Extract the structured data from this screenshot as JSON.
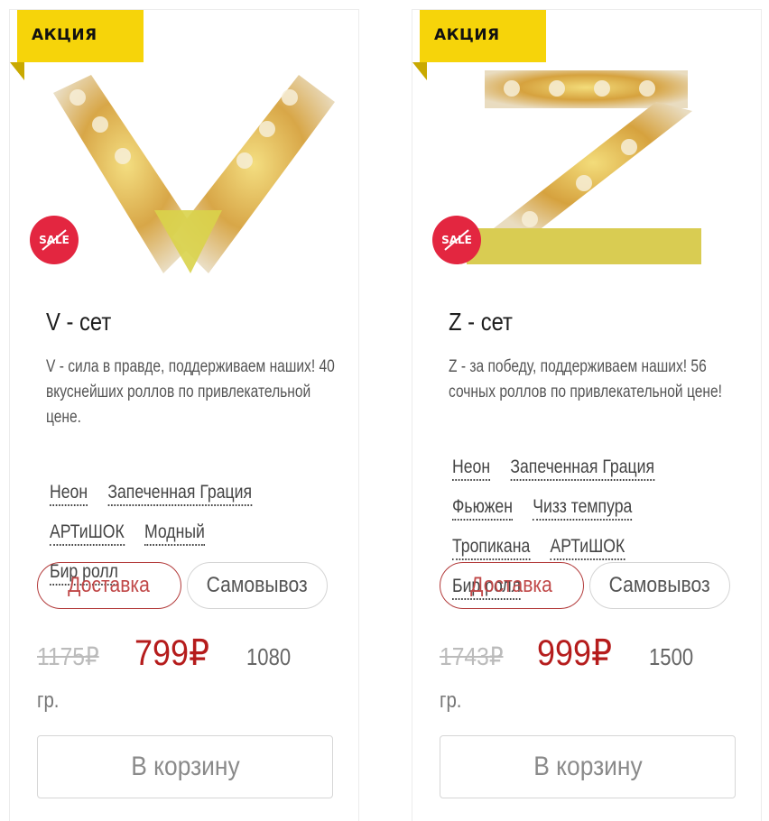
{
  "products": [
    {
      "promo_label": "АКЦИЯ",
      "sale_badge": "SALE",
      "title": "V - сет",
      "description": "V - сила в правде, поддерживаем наших! 40 вкуснейших роллов по привлекательной цене.",
      "tag_rows": [
        [
          "Неон",
          "Запеченная Грация"
        ],
        [
          "АРТиШОК",
          "Модный"
        ],
        [
          "Бир ролл"
        ]
      ],
      "delivery_option": "Доставка",
      "pickup_option": "Самовывоз",
      "old_price": "1175₽",
      "new_price": "799₽",
      "weight": "1080",
      "weight_unit": "гр.",
      "cart_button": "В корзину",
      "image_shape": "V"
    },
    {
      "promo_label": "АКЦИЯ",
      "sale_badge": "SALE",
      "title": "Z - сет",
      "description": "Z - за победу, поддерживаем наших! 56 сочных роллов по привлекательной цене!",
      "tag_rows": [
        [
          "Неон",
          "Запеченная Грация"
        ],
        [
          "Фьюжен",
          "Чизз темпура"
        ],
        [
          "Тропикана",
          "АРТиШОК"
        ],
        [
          "Бир ролл"
        ]
      ],
      "delivery_option": "Доставка",
      "pickup_option": "Самовывоз",
      "old_price": "1743₽",
      "new_price": "999₽",
      "weight": "1500",
      "weight_unit": "гр.",
      "cart_button": "В корзину",
      "image_shape": "Z"
    }
  ],
  "colors": {
    "promo_yellow": "#f6d40a",
    "sale_red": "#e32640",
    "price_red": "#b51c1c",
    "delivery_border": "#b23a3a"
  }
}
